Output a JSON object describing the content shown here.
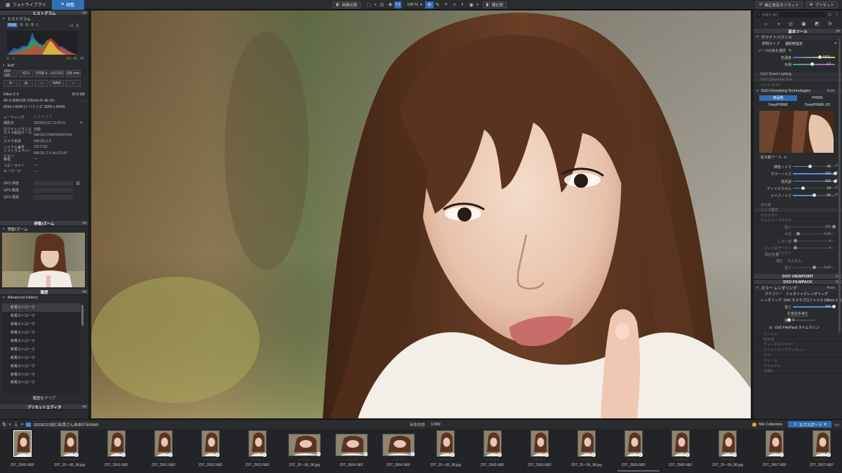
{
  "topbar": {
    "tabs": [
      {
        "label": "フォトライブラリ"
      },
      {
        "label": "調整"
      }
    ],
    "compare_label": "画像比較",
    "zoom_label": "100 %",
    "ratio_label": "1:1",
    "apply_label": "顔比較",
    "reset_label": "補正設定のリセット",
    "presets_label": "プリセット"
  },
  "left": {
    "histogram": {
      "title": "ヒストグラム",
      "sub_title": "ヒストグラム",
      "channels": [
        "RGB",
        "R",
        "G",
        "B",
        "L"
      ],
      "readout_r": "64,",
      "readout_g": "61,",
      "readout_b": "48"
    },
    "exif": {
      "title": "Exif",
      "chips_top": [
        "ISO 100",
        "f/2.0",
        "1/500 s",
        "+0.0 EV",
        "105 mm"
      ],
      "chip_raw": "RAW",
      "camera": "Nikon Z 9",
      "size": "50.8 MB",
      "lens": "AF-S NIKKOR 105mm f/1.4E ED",
      "dims": "8256 x 5504 (トリミング: 8256 x 5504)"
    },
    "meta": {
      "rows": [
        {
          "k": "レーティング",
          "v": "☆☆☆☆☆"
        },
        {
          "k": "撮影日",
          "v": "2023/01/22  13:39:01"
        },
        {
          "k": "ホワイトバランス",
          "v": "自動"
        },
        {
          "k": "カメラ製造メーカー",
          "v": "NIKON CORPORATION"
        },
        {
          "k": "カメラ本体",
          "v": "NIKON Z 9"
        },
        {
          "k": "シリアル番号",
          "v": "2017739"
        },
        {
          "k": "ソフトウェアバージョン",
          "v": "NIKON Z 9 Ver.03.00"
        },
        {
          "k": "著者",
          "v": "—"
        },
        {
          "k": "コピーライト",
          "v": "—"
        },
        {
          "k": "キーワード",
          "v": "—"
        }
      ],
      "gps": [
        {
          "k": "GPS 緯度"
        },
        {
          "k": "GPS 経度"
        },
        {
          "k": "GPS 標高"
        }
      ]
    },
    "move_zoom": {
      "title": "移動/ズーム",
      "sub_title": "移動/ズーム"
    },
    "history": {
      "title": "履歴",
      "sub_title": "Advanced History",
      "items": [
        "新規ストローク",
        "新規ストローク",
        "新規ストローク",
        "新規ストローク",
        "新規ストローク",
        "新規ストローク",
        "新規ストローク",
        "新規ストローク",
        "新規ストローク",
        "新規ストローク"
      ],
      "clear_label": "履歴をクリア"
    },
    "preset_editor": {
      "title": "プリセットエディタ"
    }
  },
  "right": {
    "search_placeholder": "検索を実行",
    "basic_tools_title": "基本ツール",
    "wb": {
      "title": "ホワイトバランス",
      "preset_label": "照明タイプ",
      "preset_value": "撮影時指定",
      "picker_label": "ソースの色を選択",
      "temp_label": "色温度",
      "temp_value": "6831",
      "tint_label": "色相",
      "tint_value": "-17"
    },
    "smart_lighting_label": "DxO Smart Lighting",
    "clearview_label": "DxO ClearView Plus",
    "contrast_label": "コントラスト",
    "denoise": {
      "title": "DxO Denoising Technologies",
      "auto_label": "Auto",
      "hq_label": "高品質",
      "prime_label": "PRIME",
      "deepprime_label": "DeepPRIME",
      "deepprime_xd_label": "DeepPRIME XD",
      "loupe_label": "拡大鏡ツール",
      "sliders": [
        {
          "label": "輝度ノイズ",
          "value": "40",
          "pct": 0.4
        },
        {
          "label": "カラーノイズ",
          "value": "100",
          "pct": 1.0
        },
        {
          "label": "低周波",
          "value": "100",
          "pct": 1.0
        },
        {
          "label": "デッドピクセル",
          "value": "24",
          "pct": 0.24
        },
        {
          "label": "メイズノイズ",
          "value": "50",
          "pct": 0.5
        }
      ]
    },
    "dim_sections": [
      {
        "label": "色収差"
      },
      {
        "label": "レンズ補正"
      },
      {
        "label": "テクスチャ"
      },
      {
        "label": "アンシャープマスク"
      }
    ],
    "unsharp": [
      {
        "label": "強さ",
        "value": "100"
      },
      {
        "label": "半径",
        "value": "0.50"
      },
      {
        "label": "しきい値",
        "value": "4"
      },
      {
        "label": "エッジのアーティファクト",
        "value": "4"
      }
    ],
    "vignette": {
      "title": "周辺光量",
      "mode_label": "補正",
      "mode_value": "カスタム",
      "amount_label": "強さ",
      "amount_value": "0.00"
    },
    "viewpoint_title": "DXO VIEWPOINT",
    "filmpack_title": "DXO FILMPACK",
    "rendering": {
      "title": "カラー レンダリング",
      "auto_label": "Auto",
      "category_label": "カテゴリー",
      "category_value": "ジェネリックレンダリング",
      "rendering_label": "レンダリング",
      "rendering_value": "DxO カメラプロファイル (Nikon Z 9)",
      "strength_label": "強さ",
      "strength_value": "100",
      "protect_label": "彩度過多補正",
      "protect_value": "0",
      "timemachine_label": "DxO FilmPack タイムマシン"
    },
    "filmpack_dim": [
      {
        "label": "フィルム"
      },
      {
        "label": "粒状感"
      },
      {
        "label": "チャンネルミキサー"
      },
      {
        "label": "クリエイティブヴィネット"
      },
      {
        "label": "ブラー"
      },
      {
        "label": "フレーム"
      },
      {
        "label": "テクスチャ"
      },
      {
        "label": "光漏れ"
      }
    ]
  },
  "bottom": {
    "folder_path": "20230122岩口彩菜さん自由が丘RAW",
    "count_label": "画像枚数",
    "count_value": "1/349",
    "nik_label": "Nik Collection",
    "export_label": "エクスポート",
    "films": [
      {
        "name": "Z9T_2560.NEF",
        "orient": "p"
      },
      {
        "name": "Z9T_25~-96_98.jpg",
        "orient": "p"
      },
      {
        "name": "Z9T_2561.NEF",
        "orient": "p"
      },
      {
        "name": "Z9T_2561.NEF",
        "orient": "p"
      },
      {
        "name": "Z9T_2562.NEF",
        "orient": "p"
      },
      {
        "name": "Z9T_2562.NEF",
        "orient": "p"
      },
      {
        "name": "Z9T_25~-96_98.jpg",
        "orient": "l"
      },
      {
        "name": "Z9T_2564.NEF",
        "orient": "l"
      },
      {
        "name": "Z9T_2564.NEF",
        "orient": "l"
      },
      {
        "name": "Z9T_25~-96_98.jpg",
        "orient": "p"
      },
      {
        "name": "Z9T_2565.NEF",
        "orient": "p"
      },
      {
        "name": "Z9T_2565.NEF",
        "orient": "p"
      },
      {
        "name": "Z9T_25~-96_98.jpg",
        "orient": "p"
      },
      {
        "name": "Z9T_2566.NEF",
        "orient": "p"
      },
      {
        "name": "Z9T_2566.NEF",
        "orient": "p"
      },
      {
        "name": "Z9T_25~-96_98.jpg",
        "orient": "p"
      },
      {
        "name": "Z9T_2567.NEF",
        "orient": "p"
      },
      {
        "name": "Z9T_2567.NEF",
        "orient": "p"
      }
    ]
  },
  "colors": {
    "accent": "#2f6fb5",
    "panel": "#2a2b2e",
    "header": "#3a3b3f"
  }
}
